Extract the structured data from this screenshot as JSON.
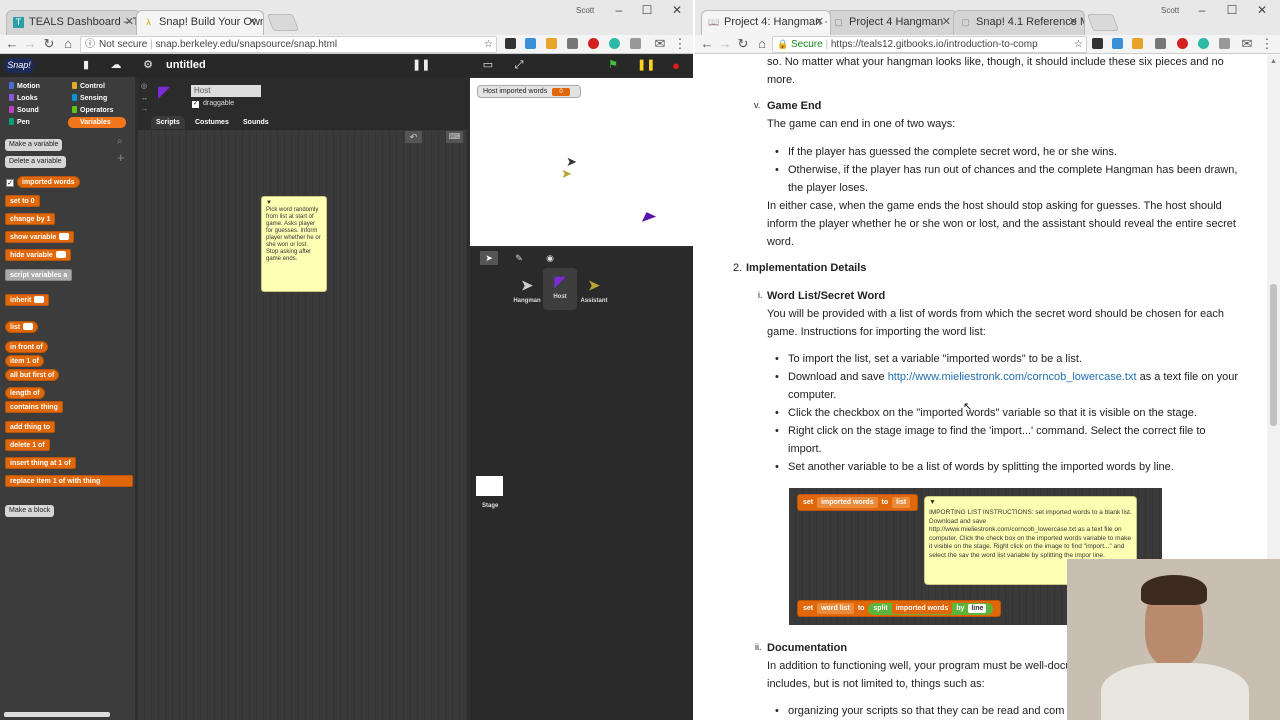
{
  "left_browser": {
    "tabs": [
      {
        "label": "TEALS Dashboard – TEAL",
        "icon": "teals-favicon"
      },
      {
        "label": "Snap! Build Your Own Bl",
        "icon": "snap-favicon"
      }
    ],
    "profile_name": "Scott",
    "toolbar": {
      "security": "Not secure",
      "url": "snap.berkeley.edu/snapsource/snap.html"
    }
  },
  "snap": {
    "logo": "Snap!",
    "project_title": "untitled",
    "categories": [
      {
        "label": "Motion",
        "color": "#4a6cd4"
      },
      {
        "label": "Control",
        "color": "#e6a822"
      },
      {
        "label": "Looks",
        "color": "#8a55d7"
      },
      {
        "label": "Sensing",
        "color": "#0494dc"
      },
      {
        "label": "Sound",
        "color": "#bb42c3"
      },
      {
        "label": "Operators",
        "color": "#62c213"
      },
      {
        "label": "Pen",
        "color": "#00a178"
      },
      {
        "label": "Variables",
        "color": "#f3761d"
      }
    ],
    "buttons": {
      "make_variable": "Make a variable",
      "delete_variable": "Delete a variable",
      "make_block": "Make a block"
    },
    "variable": "imported words",
    "blocks": [
      {
        "label": "set",
        "suffix": "to 0"
      },
      {
        "label": "change",
        "suffix": "by 1"
      },
      {
        "label": "show variable",
        "suffix": ""
      },
      {
        "label": "hide variable",
        "suffix": ""
      },
      {
        "label": "script variables",
        "suffix": "a"
      },
      {
        "label": "inherit",
        "suffix": ""
      },
      {
        "label": "list",
        "suffix": ""
      },
      {
        "label": "in front of",
        "suffix": ""
      },
      {
        "label": "item",
        "suffix": "1 of"
      },
      {
        "label": "all but first of",
        "suffix": ""
      },
      {
        "label": "length of",
        "suffix": ""
      },
      {
        "label": "contains",
        "suffix": "thing"
      },
      {
        "label": "add",
        "suffix": "thing to"
      },
      {
        "label": "delete",
        "suffix": "1 of"
      },
      {
        "label": "insert",
        "suffix": "thing at 1 of"
      },
      {
        "label": "replace item",
        "suffix": "1 of with thing"
      }
    ],
    "sprite_name": "Host",
    "draggable_label": "draggable",
    "editor_tabs": [
      "Scripts",
      "Costumes",
      "Sounds"
    ],
    "note_text": "Pick word randomly from list at start of game. Asks player for guesses. Inform player whether he or she won or lost. Stop asking after game ends.",
    "watcher_label": "Host imported words",
    "watcher_value": "0",
    "sprites": [
      {
        "name": "Hangman",
        "color": "#cfcfcf"
      },
      {
        "name": "Host",
        "color": "#7a2bd6"
      },
      {
        "name": "Assistant",
        "color": "#b8a532"
      }
    ],
    "stage_label": "Stage"
  },
  "right_browser": {
    "tabs": [
      {
        "label": "Project 4: Hangman · Intr",
        "icon": "gitbook-favicon"
      },
      {
        "label": "Project 4 Hangman",
        "icon": "doc-favicon"
      },
      {
        "label": "Snap! 4.1 Reference Man",
        "icon": "doc-favicon"
      }
    ],
    "profile_name": "Scott",
    "toolbar": {
      "security": "Secure",
      "url": "https://teals12.gitbooks.io/introduction-to-comp"
    }
  },
  "doc": {
    "intro_line1": "so. No matter what your hangman looks like, though, it should include these six pieces and no",
    "intro_line2": "more.",
    "game_end_marker": "v.",
    "game_end_title": "Game End",
    "game_end_intro": "The game can end in one of two ways:",
    "game_end_bullets": [
      "If the player has guessed the complete secret word, he or she wins.",
      "Otherwise, if the player has run out of chances and the complete Hangman has been drawn,",
      "the player loses."
    ],
    "game_end_para": [
      "In either case, when the game ends the host should stop asking for guesses. The host should",
      "inform the player whether he or she won or lost, and the assistant should reveal the entire secret",
      "word."
    ],
    "impl_marker": "2.",
    "impl_title": "Implementation Details",
    "wordlist_marker": "i.",
    "wordlist_title": "Word List/Secret Word",
    "wordlist_para": [
      "You will be provided with a list of words from which the secret word should be chosen for each",
      "game. Instructions for importing the word list:"
    ],
    "wordlist_bullets": [
      "To import the list, set a variable \"imported words\" to be a list.",
      "Download and save",
      "as a text file on your",
      "computer.",
      "Click the checkbox on the \"imported words\" variable so that it is visible on the stage.",
      "Right click on the stage image to find the 'import...' command. Select the correct file to",
      "import.",
      "Set another variable to be a list of words by splitting the imported words by line."
    ],
    "wordlist_link": "http://www.mieliestronk.com/corncob_lowercase.txt",
    "image": {
      "block1_set": "set",
      "block1_var": "imported words",
      "block1_to": "to",
      "block1_list": "list",
      "note": "IMPORTING LIST INSTRUCTIONS: set imported words to a blank list. Download and save http://www.mieliestronk.com/corncob_lowercase.txt as a text file on computer. Click the check box on the imported words variable to make it visible on the stage. Right click on the image to find \"import...\" and select the sav the word list variable by splitting the impor line.",
      "block2_set": "set",
      "block2_var": "word list",
      "block2_to": "to",
      "block2_split": "split",
      "block2_arg": "imported words",
      "block2_by": "by",
      "block2_line": "line"
    },
    "doc_marker": "ii.",
    "doc_title": "Documentation",
    "doc_para": [
      "In addition to functioning well, your program must be well-docu",
      "includes, but is not limited to, things such as:"
    ],
    "doc_bullet": "organizing your scripts so that they can be read and com"
  }
}
